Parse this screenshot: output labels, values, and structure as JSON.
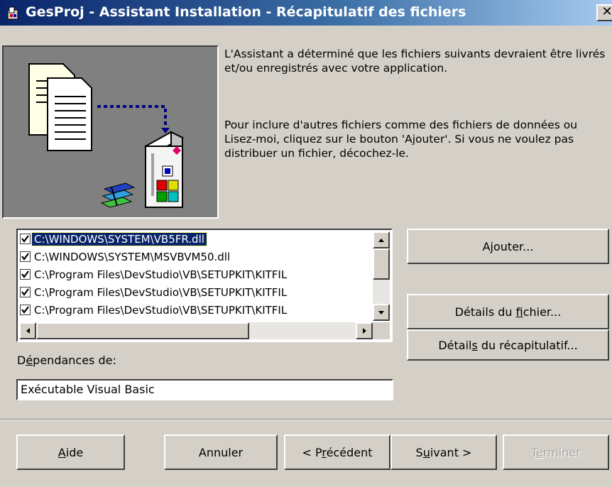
{
  "window": {
    "title": "GesProj - Assistant Installation - Récapitulatif des fichiers",
    "close_glyph": "✕"
  },
  "description": {
    "p1": "L'Assistant a déterminé que les fichiers suivants devraient être livrés et/ou enregistrés avec votre application.",
    "p2": "Pour inclure d'autres fichiers comme des fichiers de données ou Lisez-moi, cliquez sur le bouton 'Ajouter'. Si vous ne voulez pas distribuer un fichier, décochez-le."
  },
  "files": [
    {
      "path": "C:\\WINDOWS\\SYSTEM\\VB5FR.dll",
      "checked": true,
      "selected": true
    },
    {
      "path": "C:\\WINDOWS\\SYSTEM\\MSVBVM50.dll",
      "checked": true,
      "selected": false
    },
    {
      "path": "C:\\Program Files\\DevStudio\\VB\\SETUPKIT\\KITFIL",
      "checked": true,
      "selected": false
    },
    {
      "path": "C:\\Program Files\\DevStudio\\VB\\SETUPKIT\\KITFIL",
      "checked": true,
      "selected": false
    },
    {
      "path": "C:\\Program Files\\DevStudio\\VB\\SETUPKIT\\KITFIL",
      "checked": true,
      "selected": false
    }
  ],
  "buttons": {
    "add": "Ajouter...",
    "file_details": {
      "pre": "Détails du ",
      "u": "f",
      "post": "ichier..."
    },
    "summary_details": {
      "pre": "Détail",
      "u": "s",
      "post": " du récapitulatif..."
    },
    "help": {
      "pre": "",
      "u": "A",
      "post": "ide"
    },
    "cancel": "Annuler",
    "previous": {
      "pre": "< P",
      "u": "r",
      "post": "écédent"
    },
    "next": {
      "pre": "S",
      "u": "u",
      "post": "ivant >"
    },
    "finish": {
      "pre": "T",
      "u": "e",
      "post": "rminer"
    }
  },
  "dependencies": {
    "label": {
      "pre": "D",
      "u": "é",
      "post": "pendances de:"
    },
    "value": "Exécutable Visual Basic"
  },
  "colors": {
    "selection": "#0a246a",
    "face": "#d4d0c8"
  }
}
